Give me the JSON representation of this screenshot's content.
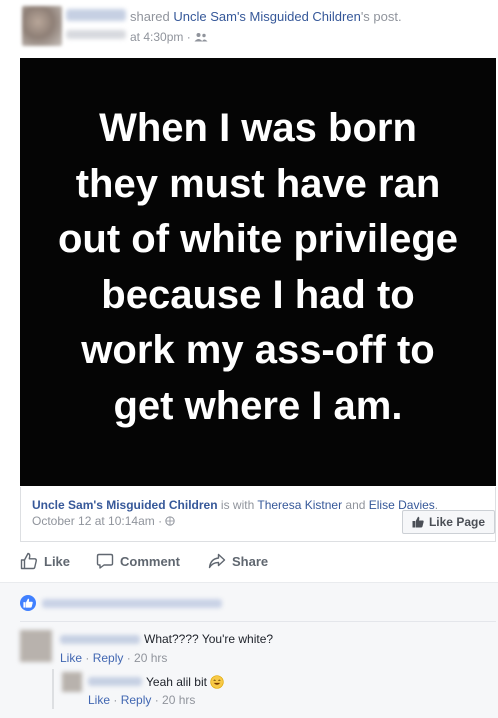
{
  "header": {
    "shared_word": "shared",
    "page_name": "Uncle Sam's Misguided Children",
    "post_suffix": "'s post.",
    "time": "at 4:30pm ·"
  },
  "meme": {
    "lines": [
      "When I was born",
      "they must have ran",
      "out of white privilege",
      "because I had to",
      "work my ass-off to",
      "get where I am."
    ]
  },
  "attribution": {
    "page_name": "Uncle Sam's Misguided Children",
    "with_text": " is with ",
    "person1": "Theresa Kistner",
    "and_text": " and ",
    "person2": "Elise Davies",
    "period": ".",
    "date": "October 12 at 10:14am ·",
    "like_page_label": "Like Page"
  },
  "actions": {
    "like": "Like",
    "comment": "Comment",
    "share": "Share"
  },
  "comments": [
    {
      "text": "What???? You're white?",
      "like": "Like",
      "reply": "Reply",
      "sep": " · ",
      "time": "20 hrs"
    },
    {
      "text": "Yeah alil bit",
      "like": "Like",
      "reply": "Reply",
      "sep": " · ",
      "time": "20 hrs"
    }
  ],
  "colors": {
    "link": "#365899",
    "meta": "#90949c",
    "like_blue": "#4080ff",
    "image_bg": "#050505"
  },
  "icons": [
    "friends-icon",
    "globe-icon",
    "thumbs-up-icon",
    "comment-icon",
    "share-icon",
    "smile-emoji-icon"
  ]
}
